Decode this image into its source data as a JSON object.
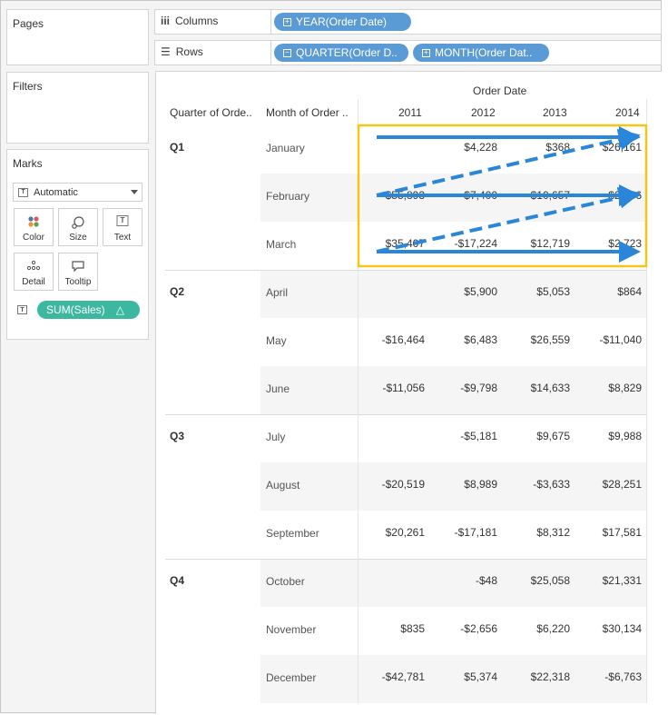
{
  "pages": {
    "title": "Pages"
  },
  "filters": {
    "title": "Filters"
  },
  "marks": {
    "title": "Marks",
    "type": "Automatic",
    "buttons": {
      "color": "Color",
      "size": "Size",
      "text": "Text",
      "detail": "Detail",
      "tooltip": "Tooltip"
    },
    "text_icon": "T",
    "pill": "SUM(Sales)",
    "pill_flag": "△"
  },
  "shelves": {
    "columns_label": "Columns",
    "columns_pill": "YEAR(Order Date)",
    "rows_label": "Rows",
    "rows_pills": [
      "QUARTER(Order D..",
      "MONTH(Order Dat.."
    ]
  },
  "table": {
    "col_group_header": "Order Date",
    "row_headers": [
      "Quarter of Orde..",
      "Month of Order .."
    ],
    "years": [
      "2011",
      "2012",
      "2013",
      "2014"
    ],
    "quarters": [
      "Q1",
      "Q2",
      "Q3",
      "Q4"
    ],
    "rows": [
      {
        "month": "January",
        "values": [
          "",
          "$4,228",
          "$368",
          "$26,161"
        ]
      },
      {
        "month": "February",
        "values": [
          "$55,893",
          "$7,400",
          "$10,657",
          "$2,596"
        ]
      },
      {
        "month": "March",
        "values": [
          "$35,407",
          "-$17,224",
          "$12,719",
          "$2,723"
        ]
      },
      {
        "month": "April",
        "values": [
          "",
          "$5,900",
          "$5,053",
          "$864"
        ]
      },
      {
        "month": "May",
        "values": [
          "-$16,464",
          "$6,483",
          "$26,559",
          "-$11,040"
        ]
      },
      {
        "month": "June",
        "values": [
          "-$11,056",
          "-$9,798",
          "$14,633",
          "$8,829"
        ]
      },
      {
        "month": "July",
        "values": [
          "",
          "-$5,181",
          "$9,675",
          "$9,988"
        ]
      },
      {
        "month": "August",
        "values": [
          "-$20,519",
          "$8,989",
          "-$3,633",
          "$28,251"
        ]
      },
      {
        "month": "September",
        "values": [
          "$20,261",
          "-$17,181",
          "$8,312",
          "$17,581"
        ]
      },
      {
        "month": "October",
        "values": [
          "",
          "-$48",
          "$25,058",
          "$21,331"
        ]
      },
      {
        "month": "November",
        "values": [
          "$835",
          "-$2,656",
          "$6,220",
          "$30,134"
        ]
      },
      {
        "month": "December",
        "values": [
          "-$42,781",
          "$5,374",
          "$22,318",
          "-$6,763"
        ]
      }
    ]
  },
  "colors": {
    "pill_blue": "#5b9bd5",
    "pill_green": "#3cb8a0",
    "highlight_box": "#f5c518",
    "arrow": "#2a86d8"
  }
}
